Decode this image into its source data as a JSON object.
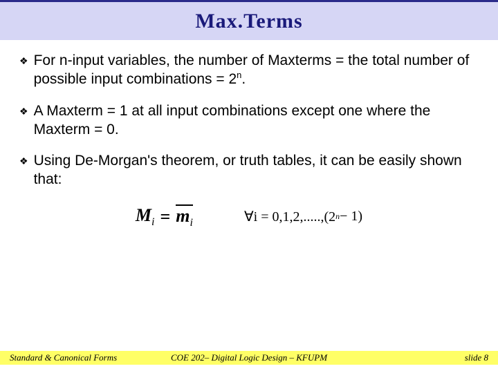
{
  "title": "Max.Terms",
  "bullets": [
    {
      "text_html": "For n-input variables, the number of Maxterms = the total number of possible input combinations = 2<span class='sup'>n</span>."
    },
    {
      "text_html": "A Maxterm = 1 at all input combinations except one where the Maxterm = 0."
    },
    {
      "text_html": "Using De-Morgan's theorem, or truth tables, it can be easily shown that:"
    }
  ],
  "formula": {
    "lhs_var": "M",
    "lhs_sub": "i",
    "rhs_var": "m",
    "rhs_sub": "i",
    "range_prefix": "∀i = 0,1,2,.....,(2",
    "range_exp": "n",
    "range_suffix": " − 1)"
  },
  "footer": {
    "left": "Standard & Canonical Forms",
    "center": "COE 202– Digital Logic Design – KFUPM",
    "right": "slide 8"
  }
}
